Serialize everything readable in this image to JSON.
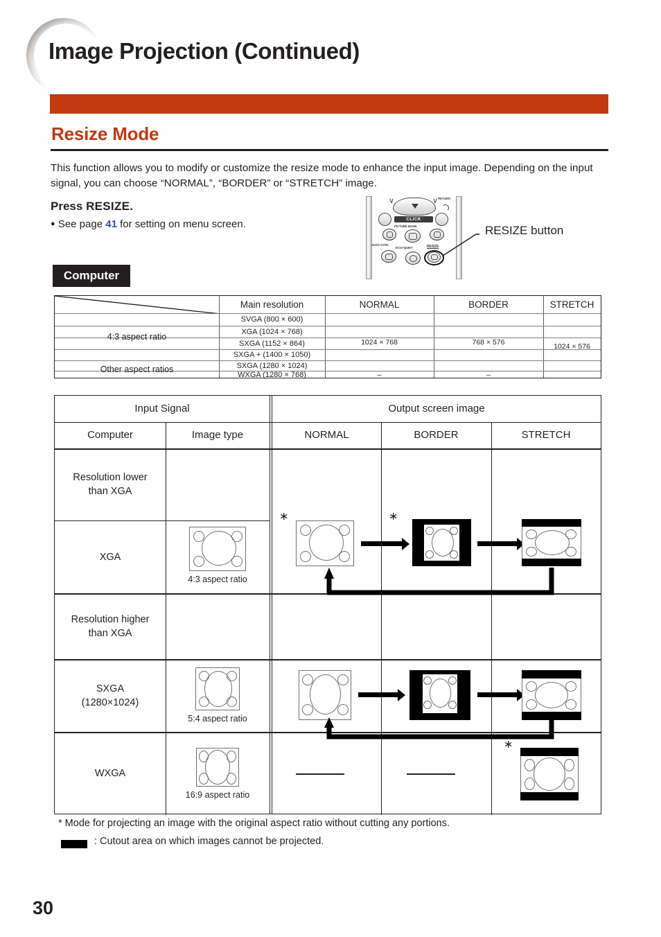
{
  "header": {
    "title": "Image Projection (Continued)",
    "section_title": "Resize Mode",
    "accent_color": "#c0390f"
  },
  "intro": {
    "paragraph": "This function allows you to modify or customize the resize mode to enhance the input image. Depending on the input signal, you can choose “NORMAL”, “BORDER” or “STRETCH” image.",
    "press_label": "Press",
    "press_key": "RESIZE.",
    "see_page_before": "See page",
    "see_page_number": "41",
    "see_page_after": "for setting on menu screen.",
    "page_link_color": "#2a52a8"
  },
  "remote": {
    "callout_label": "RESIZE button",
    "labels": {
      "return": "RETURN",
      "click": "CLICK",
      "picture_mode": "PICTURE MODE",
      "auto_sync": "AUTO SYNC",
      "eco_quiet": "ECO+QUIET",
      "resize": "RESIZE"
    }
  },
  "computer_tag": "Computer",
  "table1": {
    "columns": [
      "Main resolution",
      "NORMAL",
      "BORDER",
      "STRETCH"
    ],
    "groups": [
      "4:3 aspect ratio",
      "Other aspect ratios"
    ],
    "rows": [
      "SVGA (800 × 600)",
      "XGA (1024 × 768)",
      "SXGA (1152 × 864)",
      "SXGA + (1400 × 1050)",
      "SXGA (1280 × 1024)",
      "WXGA (1280 × 768)"
    ],
    "values": {
      "normal": "1024 × 768",
      "border": "768 × 576",
      "stretch": "1024 × 576",
      "normal_wxga": "–",
      "border_wxga": "–"
    }
  },
  "table2": {
    "group_headers": [
      "Input Signal",
      "Output screen image"
    ],
    "sub_headers": [
      "Computer",
      "Image type",
      "NORMAL",
      "BORDER",
      "STRETCH"
    ],
    "rows": [
      {
        "computer": "Resolution lower\nthan XGA",
        "image_type": "",
        "aspect_caption": ""
      },
      {
        "computer": "XGA",
        "image_type": "4:3 aspect ratio",
        "aspect_caption": "4:3 aspect ratio"
      },
      {
        "computer": "Resolution higher\nthan XGA",
        "image_type": "",
        "aspect_caption": ""
      },
      {
        "computer": "SXGA\n(1280×1024)",
        "image_type": "5:4 aspect ratio",
        "aspect_caption": "5:4 aspect ratio"
      },
      {
        "computer": "WXGA",
        "image_type": "16:9 aspect ratio",
        "aspect_caption": "16:9 aspect ratio"
      }
    ],
    "row_labels": {
      "r1": "Resolution lower",
      "r1b": "than XGA",
      "r2": "XGA",
      "r3": "Resolution higher",
      "r3b": "than XGA",
      "r4": "SXGA",
      "r4b": "(1280×1024)",
      "r5": "WXGA"
    },
    "captions": {
      "c43": "4:3 aspect ratio",
      "c54": "5:4 aspect ratio",
      "c169": "16:9 aspect ratio"
    },
    "star_mark": "∗"
  },
  "footnotes": {
    "note1": "* Mode for projecting an image with the original aspect ratio without cutting any portions.",
    "note2": ": Cutout area on which images cannot be projected."
  },
  "page_number": "30"
}
